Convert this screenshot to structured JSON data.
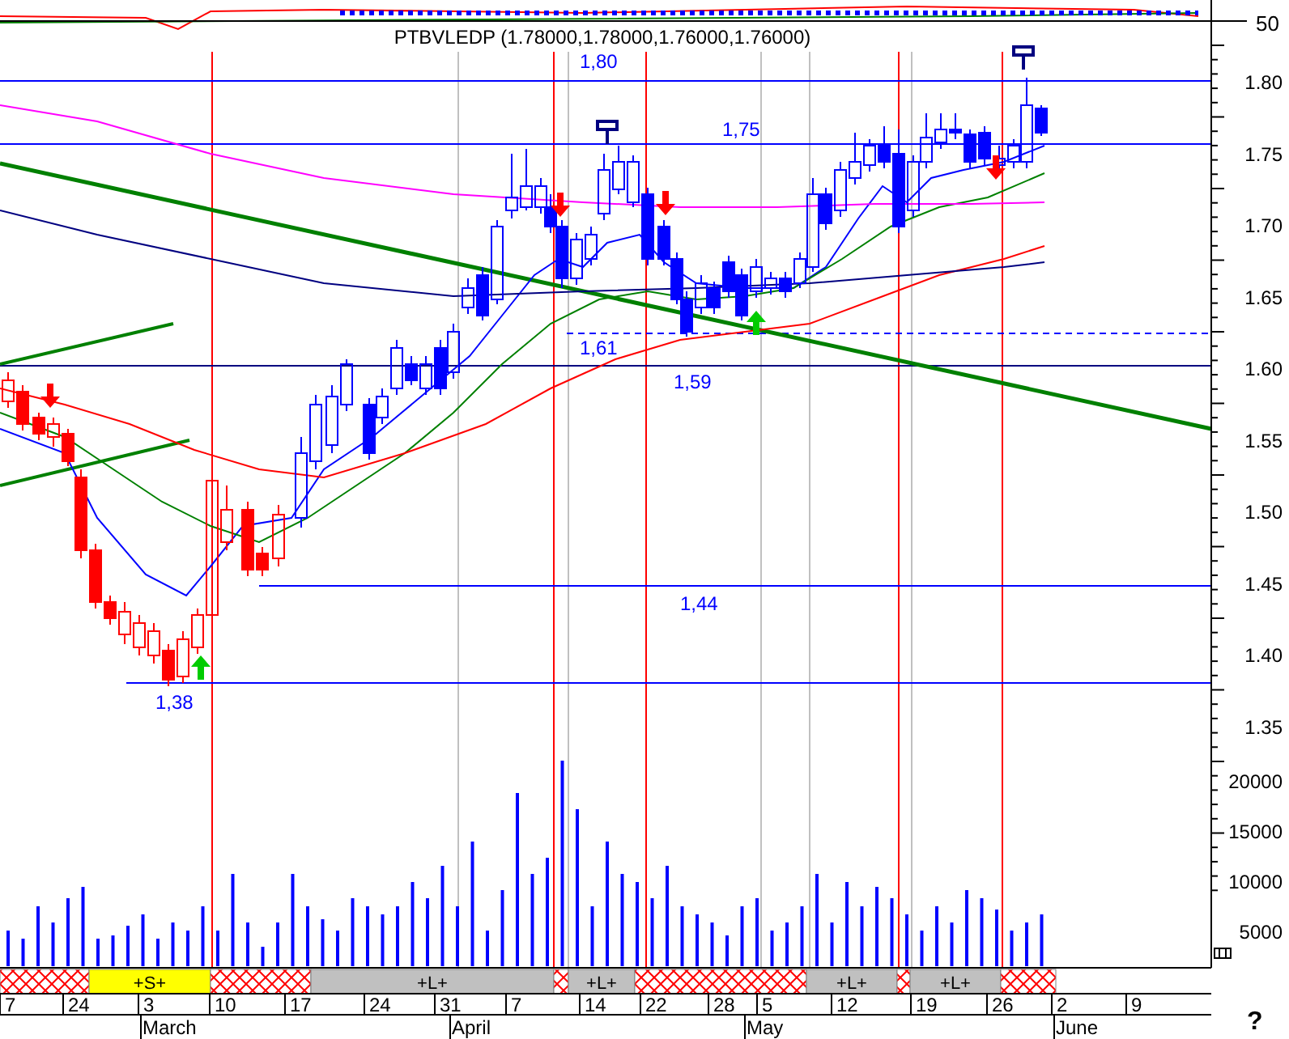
{
  "header": {
    "title": "PTBVLEDP (1.78000,1.78000,1.76000,1.76000)",
    "panel_value": "50"
  },
  "price_axis": [
    "1.80",
    "1.75",
    "1.70",
    "1.65",
    "1.60",
    "1.55",
    "1.50",
    "1.45",
    "1.40",
    "1.35"
  ],
  "volume_axis": [
    "20000",
    "15000",
    "10000",
    "5000"
  ],
  "levels": [
    {
      "label": "1,80"
    },
    {
      "label": "1,75"
    },
    {
      "label": "1,61"
    },
    {
      "label": "1,59"
    },
    {
      "label": "1,44"
    },
    {
      "label": "1,38"
    }
  ],
  "signals": [
    {
      "kind": "hatched"
    },
    {
      "kind": "short",
      "label": "+S+"
    },
    {
      "kind": "hatched"
    },
    {
      "kind": "long",
      "label": "+L+"
    },
    {
      "kind": "hatched"
    },
    {
      "kind": "long",
      "label": "+L+"
    },
    {
      "kind": "hatched"
    },
    {
      "kind": "long",
      "label": "+L+"
    },
    {
      "kind": "hatched"
    },
    {
      "kind": "long",
      "label": "+L+"
    },
    {
      "kind": "hatched"
    }
  ],
  "dates": [
    "7",
    "24",
    "3",
    "10",
    "17",
    "24",
    "31",
    "7",
    "14",
    "22",
    "28",
    "5",
    "12",
    "19",
    "26",
    "2",
    "9"
  ],
  "months": [
    "March",
    "April",
    "May",
    "June"
  ],
  "help": "?"
}
